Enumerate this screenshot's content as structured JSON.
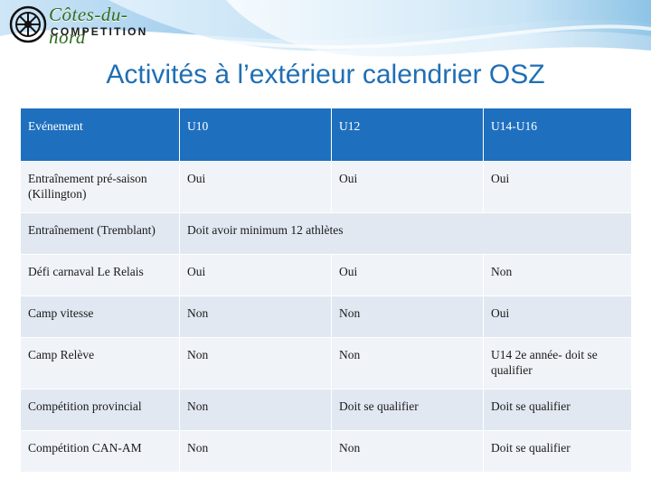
{
  "logo": {
    "brand": "Côtes-du-nord",
    "brand_display": "Côtes-du-nord",
    "subtitle": "COMPETITION",
    "mark": "gear-star-icon"
  },
  "title": "Activités à l’extérieur calendrier OSZ",
  "colors": {
    "header_blue": "#1e70bf",
    "title_blue": "#1f6fb5",
    "band_light": "#f0f3f8",
    "band_dark": "#e2e8f1"
  },
  "table": {
    "headers": [
      "Evénement",
      "U10",
      "U12",
      "U14-U16"
    ],
    "rows": [
      {
        "event": "Entraînement pré-saison (Killington)",
        "u10": "Oui",
        "u12": "Oui",
        "u14": "Oui",
        "merged": null
      },
      {
        "event": "Entraînement (Tremblant)",
        "u10": "",
        "u12": "",
        "u14": "",
        "merged": "Doit avoir minimum 12 athlètes"
      },
      {
        "event": "Défi carnaval Le Relais",
        "u10": "Oui",
        "u12": "Oui",
        "u14": "Non",
        "merged": null
      },
      {
        "event": "Camp vitesse",
        "u10": "Non",
        "u12": "Non",
        "u14": "Oui",
        "merged": null
      },
      {
        "event": "Camp Relève",
        "u10": "Non",
        "u12": "Non",
        "u14": "U14 2e année- doit se qualifier",
        "merged": null
      },
      {
        "event": "Compétition provincial",
        "u10": "Non",
        "u12": "Doit se qualifier",
        "u14": "Doit se qualifier",
        "merged": null
      },
      {
        "event": "Compétition CAN-AM",
        "u10": "Non",
        "u12": "Non",
        "u14": "Doit se qualifier",
        "merged": null
      }
    ]
  }
}
